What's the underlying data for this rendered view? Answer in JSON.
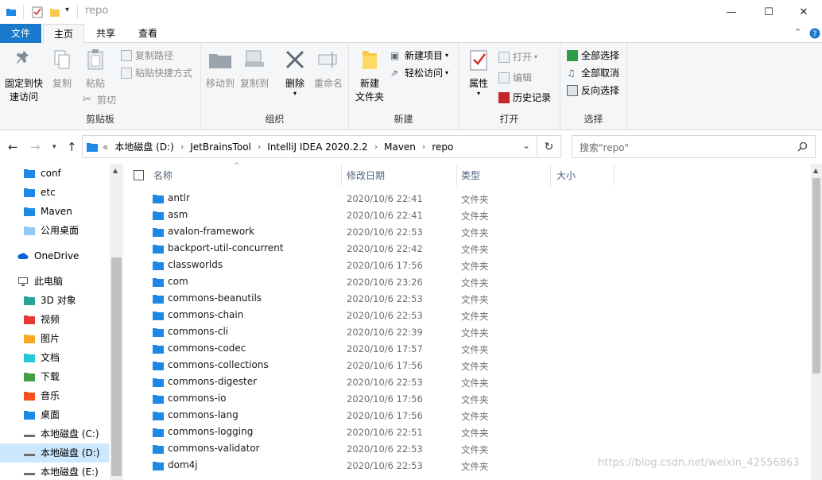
{
  "window": {
    "title": "repo",
    "minimize_glyph": "—",
    "maximize_glyph": "☐",
    "close_glyph": "✕"
  },
  "ribbon_tabs": [
    "文件",
    "主页",
    "共享",
    "查看"
  ],
  "ribbon": {
    "clipboard": {
      "label": "剪贴板",
      "pin": "固定到快速访问",
      "pin_line1": "固定到快",
      "pin_line2": "速访问",
      "copy": "复制",
      "paste": "粘贴",
      "copy_path": "复制路径",
      "paste_shortcut": "粘贴快捷方式",
      "cut": "剪切"
    },
    "organize": {
      "label": "组织",
      "move_to": "移动到",
      "copy_to": "复制到",
      "delete": "删除",
      "rename": "重命名"
    },
    "new": {
      "label": "新建",
      "new_folder_line1": "新建",
      "new_folder_line2": "文件夹",
      "new_item": "新建项目",
      "easy_access": "轻松访问"
    },
    "open": {
      "label": "打开",
      "properties": "属性",
      "open": "打开",
      "edit": "编辑",
      "history": "历史记录"
    },
    "select": {
      "label": "选择",
      "select_all": "全部选择",
      "select_none": "全部取消",
      "invert": "反向选择"
    }
  },
  "address": {
    "overflow": "«",
    "crumbs": [
      "本地磁盘 (D:)",
      "JetBrainsTool",
      "IntelliJ IDEA 2020.2.2",
      "Maven",
      "repo"
    ],
    "search_placeholder": "搜索\"repo\""
  },
  "nav_pane": {
    "items": [
      {
        "label": "conf",
        "icon": "folder-icon",
        "color": "#1e88e5"
      },
      {
        "label": "etc",
        "icon": "folder-icon",
        "color": "#1e88e5"
      },
      {
        "label": "Maven",
        "icon": "folder-icon",
        "color": "#1e88e5"
      },
      {
        "label": "公用桌面",
        "icon": "desktop-folder-icon",
        "color": "#90caf9"
      },
      {
        "label": "OneDrive",
        "icon": "cloud-icon",
        "color": "#0a64d8"
      },
      {
        "label": "此电脑",
        "icon": "computer-icon",
        "color": "#555555"
      },
      {
        "label": "3D 对象",
        "icon": "3d-objects-icon",
        "color": "#26a69a"
      },
      {
        "label": "视频",
        "icon": "video-icon",
        "color": "#e53935"
      },
      {
        "label": "图片",
        "icon": "pictures-icon",
        "color": "#f9a825"
      },
      {
        "label": "文档",
        "icon": "documents-icon",
        "color": "#26c6da"
      },
      {
        "label": "下载",
        "icon": "downloads-icon",
        "color": "#43a047"
      },
      {
        "label": "音乐",
        "icon": "music-icon",
        "color": "#f4511e"
      },
      {
        "label": "桌面",
        "icon": "desktop-icon",
        "color": "#1e88e5"
      },
      {
        "label": "本地磁盘 (C:)",
        "icon": "drive-icon",
        "color": "#6d6d6d"
      },
      {
        "label": "本地磁盘 (D:)",
        "icon": "drive-icon",
        "color": "#6d6d6d",
        "selected": true
      },
      {
        "label": "本地磁盘 (E:)",
        "icon": "drive-icon",
        "color": "#6d6d6d"
      }
    ]
  },
  "columns": {
    "name": "名称",
    "modified": "修改日期",
    "type": "类型",
    "size": "大小"
  },
  "files": [
    {
      "name": "antlr",
      "modified": "2020/10/6 22:41",
      "type": "文件夹"
    },
    {
      "name": "asm",
      "modified": "2020/10/6 22:41",
      "type": "文件夹"
    },
    {
      "name": "avalon-framework",
      "modified": "2020/10/6 22:53",
      "type": "文件夹"
    },
    {
      "name": "backport-util-concurrent",
      "modified": "2020/10/6 22:42",
      "type": "文件夹"
    },
    {
      "name": "classworlds",
      "modified": "2020/10/6 17:56",
      "type": "文件夹"
    },
    {
      "name": "com",
      "modified": "2020/10/6 23:26",
      "type": "文件夹"
    },
    {
      "name": "commons-beanutils",
      "modified": "2020/10/6 22:53",
      "type": "文件夹"
    },
    {
      "name": "commons-chain",
      "modified": "2020/10/6 22:53",
      "type": "文件夹"
    },
    {
      "name": "commons-cli",
      "modified": "2020/10/6 22:39",
      "type": "文件夹"
    },
    {
      "name": "commons-codec",
      "modified": "2020/10/6 17:57",
      "type": "文件夹"
    },
    {
      "name": "commons-collections",
      "modified": "2020/10/6 17:56",
      "type": "文件夹"
    },
    {
      "name": "commons-digester",
      "modified": "2020/10/6 22:53",
      "type": "文件夹"
    },
    {
      "name": "commons-io",
      "modified": "2020/10/6 17:56",
      "type": "文件夹"
    },
    {
      "name": "commons-lang",
      "modified": "2020/10/6 17:56",
      "type": "文件夹"
    },
    {
      "name": "commons-logging",
      "modified": "2020/10/6 22:51",
      "type": "文件夹"
    },
    {
      "name": "commons-validator",
      "modified": "2020/10/6 22:53",
      "type": "文件夹"
    },
    {
      "name": "dom4j",
      "modified": "2020/10/6 22:53",
      "type": "文件夹"
    }
  ],
  "watermark": "https://blog.csdn.net/weixin_42556863",
  "colors": {
    "accent": "#1979ca",
    "folder": "#1e88e5",
    "selection": "#cce8ff"
  }
}
